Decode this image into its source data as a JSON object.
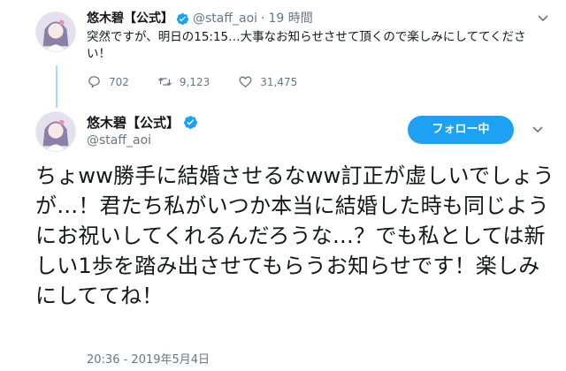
{
  "reply_tweet": {
    "display_name": "悠木碧【公式】",
    "handle": "@staff_aoi",
    "separator": "·",
    "time_ago": "19 時間",
    "text": "突然ですが、明日の15:15…大事なお知らせさせて頂くので楽しみにしててください！",
    "replies": "702",
    "retweets": "9,123",
    "likes": "31,475"
  },
  "main_tweet": {
    "display_name": "悠木碧【公式】",
    "handle": "@staff_aoi",
    "follow_label": "フォロー中",
    "text": "ちょww勝手に結婚させるなww訂正が虚しいでしょうが…！君たち私がいつか本当に結婚した時も同じようにお祝いしてくれるんだろうな…？でも私としては新しい1歩を踏み出させてもらうお知らせです！楽しみにしててね！",
    "timestamp": "20:36 - 2019年5月4日"
  },
  "colors": {
    "accent": "#1da1f2",
    "thread_line": "#a9dcf8",
    "muted": "#657786",
    "text": "#14171a"
  },
  "icons": [
    "verified-badge-icon",
    "chevron-down-icon",
    "reply-icon",
    "retweet-icon",
    "like-heart-icon"
  ]
}
